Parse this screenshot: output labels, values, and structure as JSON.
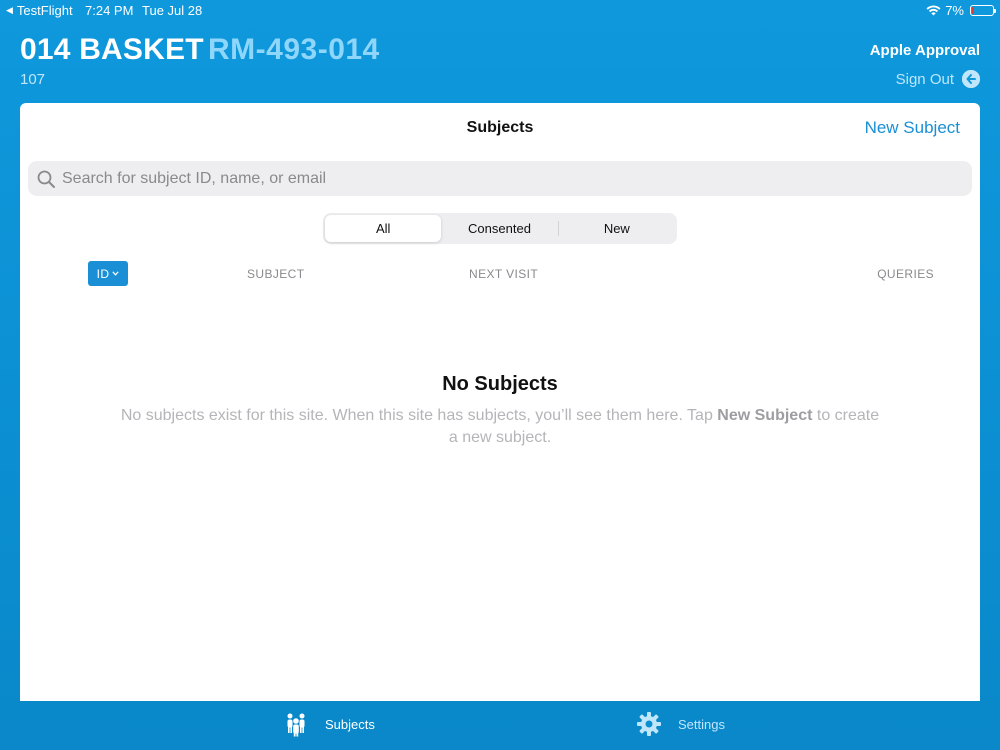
{
  "status_bar": {
    "back_app": "TestFlight",
    "time": "7:24 PM",
    "date": "Tue Jul 28",
    "battery": "7%",
    "battery_level": 0.07
  },
  "header": {
    "site_name": "014 BASKET",
    "site_code": "RM-493-014",
    "site_number": "107",
    "account_name": "Apple Approval",
    "sign_out_label": "Sign Out"
  },
  "main": {
    "title": "Subjects",
    "new_subject_label": "New Subject",
    "search": {
      "placeholder": "Search for subject ID, name, or email",
      "value": ""
    },
    "filter_tabs": [
      {
        "label": "All",
        "selected": true
      },
      {
        "label": "Consented",
        "selected": false
      },
      {
        "label": "New",
        "selected": false
      }
    ],
    "columns": {
      "sort_label": "ID",
      "subject": "SUBJECT",
      "next_visit": "NEXT VISIT",
      "queries": "QUERIES"
    },
    "empty_state": {
      "title": "No Subjects",
      "message_before": "No subjects exist for this site. When this site has subjects, you’ll see them here. Tap ",
      "message_bold": "New Subject",
      "message_after": " to create a new subject."
    }
  },
  "tab_bar": {
    "items": [
      {
        "label": "Subjects",
        "icon": "people-icon",
        "active": true
      },
      {
        "label": "Settings",
        "icon": "gear-icon",
        "active": false
      }
    ]
  },
  "colors": {
    "accent": "#1a8fd6",
    "background": "#0f98dc",
    "site_code": "#8fd6fb"
  }
}
